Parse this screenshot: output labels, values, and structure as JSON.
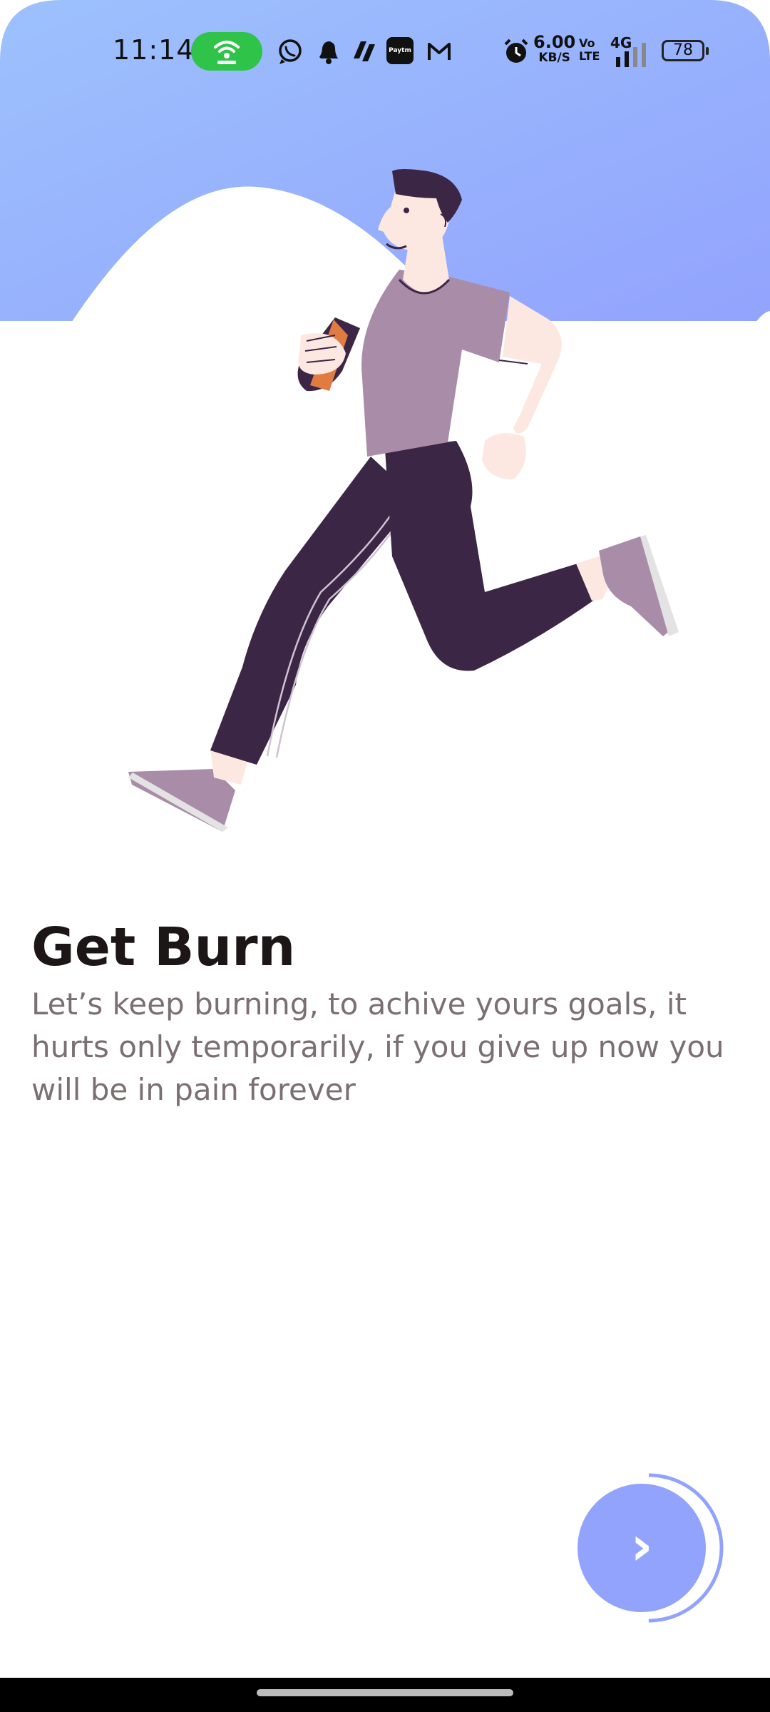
{
  "status_bar": {
    "time": "11:14",
    "net_speed_value": "6.00",
    "net_speed_unit": "KB/S",
    "volte_top": "Vo",
    "volte_bottom": "LTE",
    "network_type": "4G",
    "battery_level": "78",
    "notification_icons": [
      "whatsapp-icon",
      "bell-icon",
      "stripes-app-icon",
      "paytm-icon",
      "gmail-icon"
    ],
    "paytm_label": "Paytm"
  },
  "onboarding": {
    "title": "Get Burn",
    "description": "Let’s keep burning, to achive yours goals, it hurts only temporarily, if you give up now you will be in pain forever",
    "next_button_glyph": "›",
    "progress": 0.5
  },
  "colors": {
    "gradient_start": "#9dc1fd",
    "gradient_end": "#92a3fd",
    "title": "#1d1617",
    "body": "#7b6f72",
    "shirt": "#a98ca8",
    "pants": "#3c2645",
    "skin": "#fde8e1",
    "button": "#92a3fd"
  }
}
